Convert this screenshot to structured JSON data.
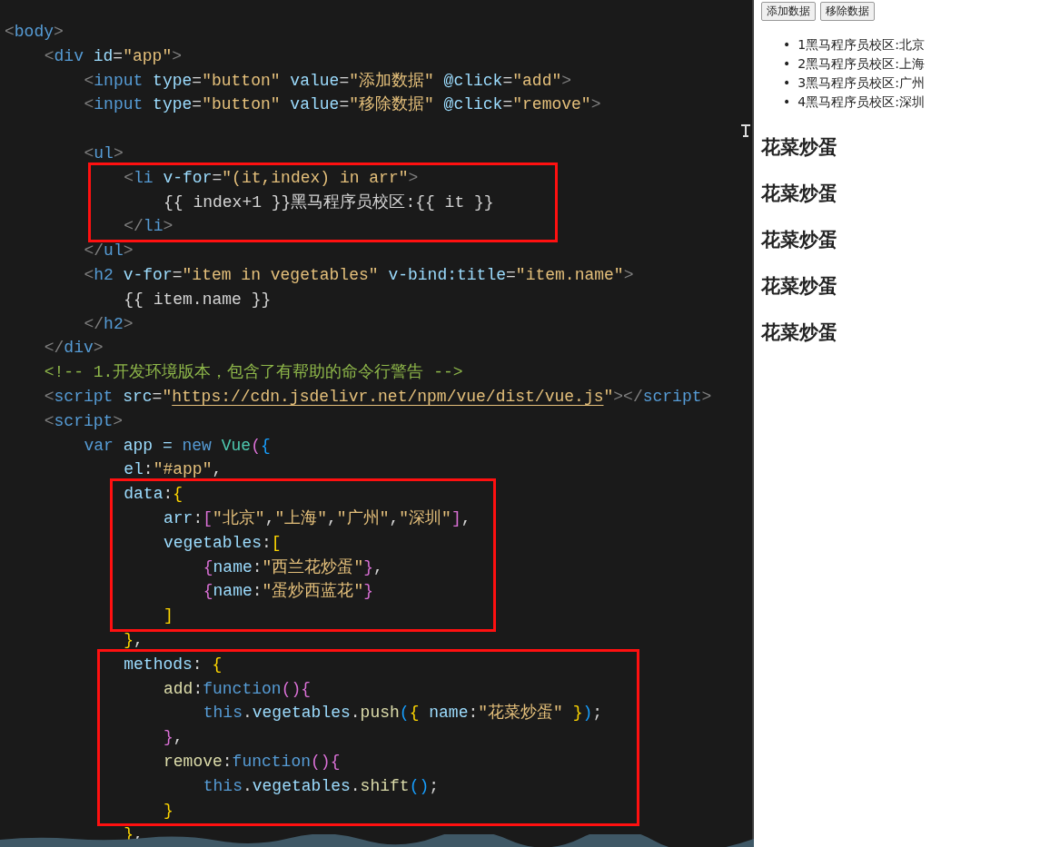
{
  "editor": {
    "lines": [
      {
        "kind": "code",
        "tokens": [
          {
            "t": "<",
            "kind": "p"
          },
          {
            "t": "body",
            "kind": "tag"
          },
          {
            "t": ">",
            "kind": "p"
          }
        ],
        "children": [
          {
            "kind": "code",
            "tokens": [
              {
                "t": "<",
                "kind": "p"
              },
              {
                "t": "div",
                "kind": "tag"
              },
              {
                "t": " id",
                "kind": "attr"
              },
              {
                "t": "=",
                "kind": "x"
              },
              {
                "t": "\"app\"",
                "kind": "s"
              },
              {
                "t": ">",
                "kind": "p"
              }
            ],
            "children": [
              {
                "kind": "code",
                "tokens": [
                  {
                    "t": "<",
                    "kind": "p"
                  },
                  {
                    "t": "input",
                    "kind": "tag"
                  },
                  {
                    "t": " type",
                    "kind": "attr"
                  },
                  {
                    "t": "=",
                    "kind": "x"
                  },
                  {
                    "t": "\"button\"",
                    "kind": "s"
                  },
                  {
                    "t": " value",
                    "kind": "attr"
                  },
                  {
                    "t": "=",
                    "kind": "x"
                  },
                  {
                    "t": "\"添加数据\"",
                    "kind": "s"
                  },
                  {
                    "t": " @click",
                    "kind": "attr"
                  },
                  {
                    "t": "=",
                    "kind": "x"
                  },
                  {
                    "t": "\"add\"",
                    "kind": "s"
                  },
                  {
                    "t": ">",
                    "kind": "p"
                  }
                ]
              },
              {
                "kind": "code",
                "tokens": [
                  {
                    "t": "<",
                    "kind": "p"
                  },
                  {
                    "t": "input",
                    "kind": "tag"
                  },
                  {
                    "t": " type",
                    "kind": "attr"
                  },
                  {
                    "t": "=",
                    "kind": "x"
                  },
                  {
                    "t": "\"button\"",
                    "kind": "s"
                  },
                  {
                    "t": " value",
                    "kind": "attr"
                  },
                  {
                    "t": "=",
                    "kind": "x"
                  },
                  {
                    "t": "\"移除数据\"",
                    "kind": "s"
                  },
                  {
                    "t": " @click",
                    "kind": "attr"
                  },
                  {
                    "t": "=",
                    "kind": "x"
                  },
                  {
                    "t": "\"remove\"",
                    "kind": "s"
                  },
                  {
                    "t": ">",
                    "kind": "p"
                  }
                ]
              },
              {
                "kind": "blank"
              },
              {
                "kind": "code",
                "tokens": [
                  {
                    "t": "<",
                    "kind": "p"
                  },
                  {
                    "t": "ul",
                    "kind": "tag"
                  },
                  {
                    "t": ">",
                    "kind": "p"
                  }
                ],
                "children": [
                  {
                    "kind": "frame",
                    "children": [
                      {
                        "kind": "code",
                        "tokens": [
                          {
                            "t": "<",
                            "kind": "p"
                          },
                          {
                            "t": "li",
                            "kind": "tag"
                          },
                          {
                            "t": " v-for",
                            "kind": "attr"
                          },
                          {
                            "t": "=",
                            "kind": "x"
                          },
                          {
                            "t": "\"(it,index) in arr\"",
                            "kind": "s"
                          },
                          {
                            "t": ">",
                            "kind": "p"
                          }
                        ],
                        "children": [
                          {
                            "kind": "code",
                            "tokens": [
                              {
                                "t": "{{ index+1 }}黑马程序员校区:{{ it }}",
                                "kind": "x"
                              }
                            ]
                          }
                        ]
                      },
                      {
                        "kind": "code",
                        "tokens": [
                          {
                            "t": "</",
                            "kind": "p"
                          },
                          {
                            "t": "li",
                            "kind": "tag"
                          },
                          {
                            "t": ">",
                            "kind": "p"
                          }
                        ]
                      }
                    ]
                  }
                ]
              },
              {
                "kind": "code",
                "tokens": [
                  {
                    "t": "</",
                    "kind": "p"
                  },
                  {
                    "t": "ul",
                    "kind": "tag"
                  },
                  {
                    "t": ">",
                    "kind": "p"
                  }
                ]
              },
              {
                "kind": "code",
                "tokens": [
                  {
                    "t": "<",
                    "kind": "p"
                  },
                  {
                    "t": "h2",
                    "kind": "tag"
                  },
                  {
                    "t": " v-for",
                    "kind": "attr"
                  },
                  {
                    "t": "=",
                    "kind": "x"
                  },
                  {
                    "t": "\"item in vegetables\"",
                    "kind": "s"
                  },
                  {
                    "t": " v-bind:title",
                    "kind": "attr"
                  },
                  {
                    "t": "=",
                    "kind": "x"
                  },
                  {
                    "t": "\"item.name\"",
                    "kind": "s"
                  },
                  {
                    "t": ">",
                    "kind": "p"
                  }
                ],
                "children": [
                  {
                    "kind": "code",
                    "tokens": [
                      {
                        "t": "{{ item.name }}",
                        "kind": "x"
                      }
                    ]
                  }
                ]
              },
              {
                "kind": "code",
                "tokens": [
                  {
                    "t": "</",
                    "kind": "p"
                  },
                  {
                    "t": "h2",
                    "kind": "tag"
                  },
                  {
                    "t": ">",
                    "kind": "p"
                  }
                ]
              }
            ]
          },
          {
            "kind": "code",
            "tokens": [
              {
                "t": "</",
                "kind": "p"
              },
              {
                "t": "div",
                "kind": "tag"
              },
              {
                "t": ">",
                "kind": "p"
              }
            ]
          },
          {
            "kind": "code",
            "tokens": [
              {
                "t": "<!-- 1.开发环境版本，包含了有帮助的命令行警告 -->",
                "kind": "c"
              }
            ]
          },
          {
            "kind": "code",
            "tokens": [
              {
                "t": "<",
                "kind": "p"
              },
              {
                "t": "script",
                "kind": "tag"
              },
              {
                "t": " src",
                "kind": "attr"
              },
              {
                "t": "=",
                "kind": "x"
              },
              {
                "t": "\"",
                "kind": "s"
              },
              {
                "t": "https://cdn.jsdelivr.net/npm/vue/dist/vue.js",
                "kind": "url"
              },
              {
                "t": "\"",
                "kind": "s"
              },
              {
                "t": "></",
                "kind": "p"
              },
              {
                "t": "script",
                "kind": "tag"
              },
              {
                "t": ">",
                "kind": "p"
              }
            ]
          },
          {
            "kind": "code",
            "tokens": [
              {
                "t": "<",
                "kind": "p"
              },
              {
                "t": "script",
                "kind": "tag"
              },
              {
                "t": ">",
                "kind": "p"
              }
            ],
            "children": [
              {
                "kind": "code",
                "tokens": [
                  {
                    "t": "var",
                    "kind": "kw"
                  },
                  {
                    "t": " app = ",
                    "kind": "prop"
                  },
                  {
                    "t": "new",
                    "kind": "kw"
                  },
                  {
                    "t": " Vue",
                    "kind": "cls"
                  },
                  {
                    "t": "(",
                    "kind": "b2"
                  },
                  {
                    "t": "{",
                    "kind": "b3"
                  }
                ],
                "children": [
                  {
                    "kind": "code",
                    "tokens": [
                      {
                        "t": "el",
                        "kind": "prop"
                      },
                      {
                        "t": ":",
                        "kind": "x"
                      },
                      {
                        "t": "\"#app\"",
                        "kind": "s"
                      },
                      {
                        "t": ",",
                        "kind": "x"
                      }
                    ]
                  },
                  {
                    "kind": "frame",
                    "children": [
                      {
                        "kind": "code",
                        "tokens": [
                          {
                            "t": "data",
                            "kind": "prop"
                          },
                          {
                            "t": ":",
                            "kind": "x"
                          },
                          {
                            "t": "{",
                            "kind": "b1"
                          }
                        ],
                        "children": [
                          {
                            "kind": "code",
                            "tokens": [
                              {
                                "t": "arr",
                                "kind": "prop"
                              },
                              {
                                "t": ":",
                                "kind": "x"
                              },
                              {
                                "t": "[",
                                "kind": "b2"
                              },
                              {
                                "t": "\"北京\"",
                                "kind": "s"
                              },
                              {
                                "t": ",",
                                "kind": "x"
                              },
                              {
                                "t": "\"上海\"",
                                "kind": "s"
                              },
                              {
                                "t": ",",
                                "kind": "x"
                              },
                              {
                                "t": "\"广州\"",
                                "kind": "s"
                              },
                              {
                                "t": ",",
                                "kind": "x"
                              },
                              {
                                "t": "\"深圳\"",
                                "kind": "s"
                              },
                              {
                                "t": "]",
                                "kind": "b2"
                              },
                              {
                                "t": ",",
                                "kind": "x"
                              }
                            ]
                          },
                          {
                            "kind": "code",
                            "tokens": [
                              {
                                "t": "vegetables",
                                "kind": "prop"
                              },
                              {
                                "t": ":",
                                "kind": "x"
                              },
                              {
                                "t": "[",
                                "kind": "b1"
                              }
                            ],
                            "children": [
                              {
                                "kind": "code",
                                "tokens": [
                                  {
                                    "t": "{",
                                    "kind": "b2"
                                  },
                                  {
                                    "t": "name",
                                    "kind": "prop"
                                  },
                                  {
                                    "t": ":",
                                    "kind": "x"
                                  },
                                  {
                                    "t": "\"西兰花炒蛋\"",
                                    "kind": "s"
                                  },
                                  {
                                    "t": "}",
                                    "kind": "b2"
                                  },
                                  {
                                    "t": ",",
                                    "kind": "x"
                                  }
                                ]
                              },
                              {
                                "kind": "code",
                                "tokens": [
                                  {
                                    "t": "{",
                                    "kind": "b2"
                                  },
                                  {
                                    "t": "name",
                                    "kind": "prop"
                                  },
                                  {
                                    "t": ":",
                                    "kind": "x"
                                  },
                                  {
                                    "t": "\"蛋炒西蓝花\"",
                                    "kind": "s"
                                  },
                                  {
                                    "t": "}",
                                    "kind": "b2"
                                  }
                                ]
                              }
                            ]
                          },
                          {
                            "kind": "code",
                            "tokens": [
                              {
                                "t": "]",
                                "kind": "b1"
                              }
                            ]
                          }
                        ]
                      }
                    ]
                  },
                  {
                    "kind": "code",
                    "tokens": [
                      {
                        "t": "}",
                        "kind": "b1"
                      },
                      {
                        "t": ",",
                        "kind": "x"
                      }
                    ]
                  },
                  {
                    "kind": "frame",
                    "children": [
                      {
                        "kind": "code",
                        "tokens": [
                          {
                            "t": "methods",
                            "kind": "prop"
                          },
                          {
                            "t": ": ",
                            "kind": "x"
                          },
                          {
                            "t": "{",
                            "kind": "b1"
                          }
                        ],
                        "children": [
                          {
                            "kind": "code",
                            "tokens": [
                              {
                                "t": "add",
                                "kind": "fn"
                              },
                              {
                                "t": ":",
                                "kind": "x"
                              },
                              {
                                "t": "function",
                                "kind": "kw"
                              },
                              {
                                "t": "()",
                                "kind": "b2"
                              },
                              {
                                "t": "{",
                                "kind": "b2"
                              }
                            ],
                            "children": [
                              {
                                "kind": "code",
                                "tokens": [
                                  {
                                    "t": "this",
                                    "kind": "kw"
                                  },
                                  {
                                    "t": ".",
                                    "kind": "x"
                                  },
                                  {
                                    "t": "vegetables",
                                    "kind": "prop"
                                  },
                                  {
                                    "t": ".",
                                    "kind": "x"
                                  },
                                  {
                                    "t": "push",
                                    "kind": "fn"
                                  },
                                  {
                                    "t": "(",
                                    "kind": "b3"
                                  },
                                  {
                                    "t": "{",
                                    "kind": "b1"
                                  },
                                  {
                                    "t": " name",
                                    "kind": "prop"
                                  },
                                  {
                                    "t": ":",
                                    "kind": "x"
                                  },
                                  {
                                    "t": "\"花菜炒蛋\" ",
                                    "kind": "s"
                                  },
                                  {
                                    "t": "}",
                                    "kind": "b1"
                                  },
                                  {
                                    "t": ")",
                                    "kind": "b3"
                                  },
                                  {
                                    "t": ";",
                                    "kind": "x"
                                  }
                                ]
                              }
                            ]
                          },
                          {
                            "kind": "code",
                            "tokens": [
                              {
                                "t": "}",
                                "kind": "b2"
                              },
                              {
                                "t": ",",
                                "kind": "x"
                              }
                            ]
                          },
                          {
                            "kind": "code",
                            "tokens": [
                              {
                                "t": "remove",
                                "kind": "fn"
                              },
                              {
                                "t": ":",
                                "kind": "x"
                              },
                              {
                                "t": "function",
                                "kind": "kw"
                              },
                              {
                                "t": "()",
                                "kind": "b2"
                              },
                              {
                                "t": "{",
                                "kind": "b2"
                              }
                            ],
                            "children": [
                              {
                                "kind": "code",
                                "tokens": [
                                  {
                                    "t": "this",
                                    "kind": "kw"
                                  },
                                  {
                                    "t": ".",
                                    "kind": "x"
                                  },
                                  {
                                    "t": "vegetables",
                                    "kind": "prop"
                                  },
                                  {
                                    "t": ".",
                                    "kind": "x"
                                  },
                                  {
                                    "t": "shift",
                                    "kind": "fn"
                                  },
                                  {
                                    "t": "()",
                                    "kind": "b3"
                                  },
                                  {
                                    "t": ";",
                                    "kind": "x"
                                  }
                                ]
                              }
                            ]
                          },
                          {
                            "kind": "code",
                            "tokens": [
                              {
                                "t": "}",
                                "kind": "b1"
                              }
                            ]
                          }
                        ]
                      }
                    ]
                  },
                  {
                    "kind": "code",
                    "tokens": [
                      {
                        "t": "}",
                        "kind": "b1"
                      },
                      {
                        "t": ",",
                        "kind": "x"
                      }
                    ]
                  }
                ]
              }
            ]
          }
        ]
      }
    ]
  },
  "preview": {
    "buttons": [
      "添加数据",
      "移除数据"
    ],
    "list": [
      {
        "marker": "•",
        "text": "1黑马程序员校区:北京"
      },
      {
        "marker": "•",
        "text": "2黑马程序员校区:上海"
      },
      {
        "marker": "•",
        "text": "3黑马程序员校区:广州"
      },
      {
        "marker": "•",
        "text": "4黑马程序员校区:深圳"
      }
    ],
    "headings": [
      "花菜炒蛋",
      "花菜炒蛋",
      "花菜炒蛋",
      "花菜炒蛋",
      "花菜炒蛋"
    ]
  }
}
